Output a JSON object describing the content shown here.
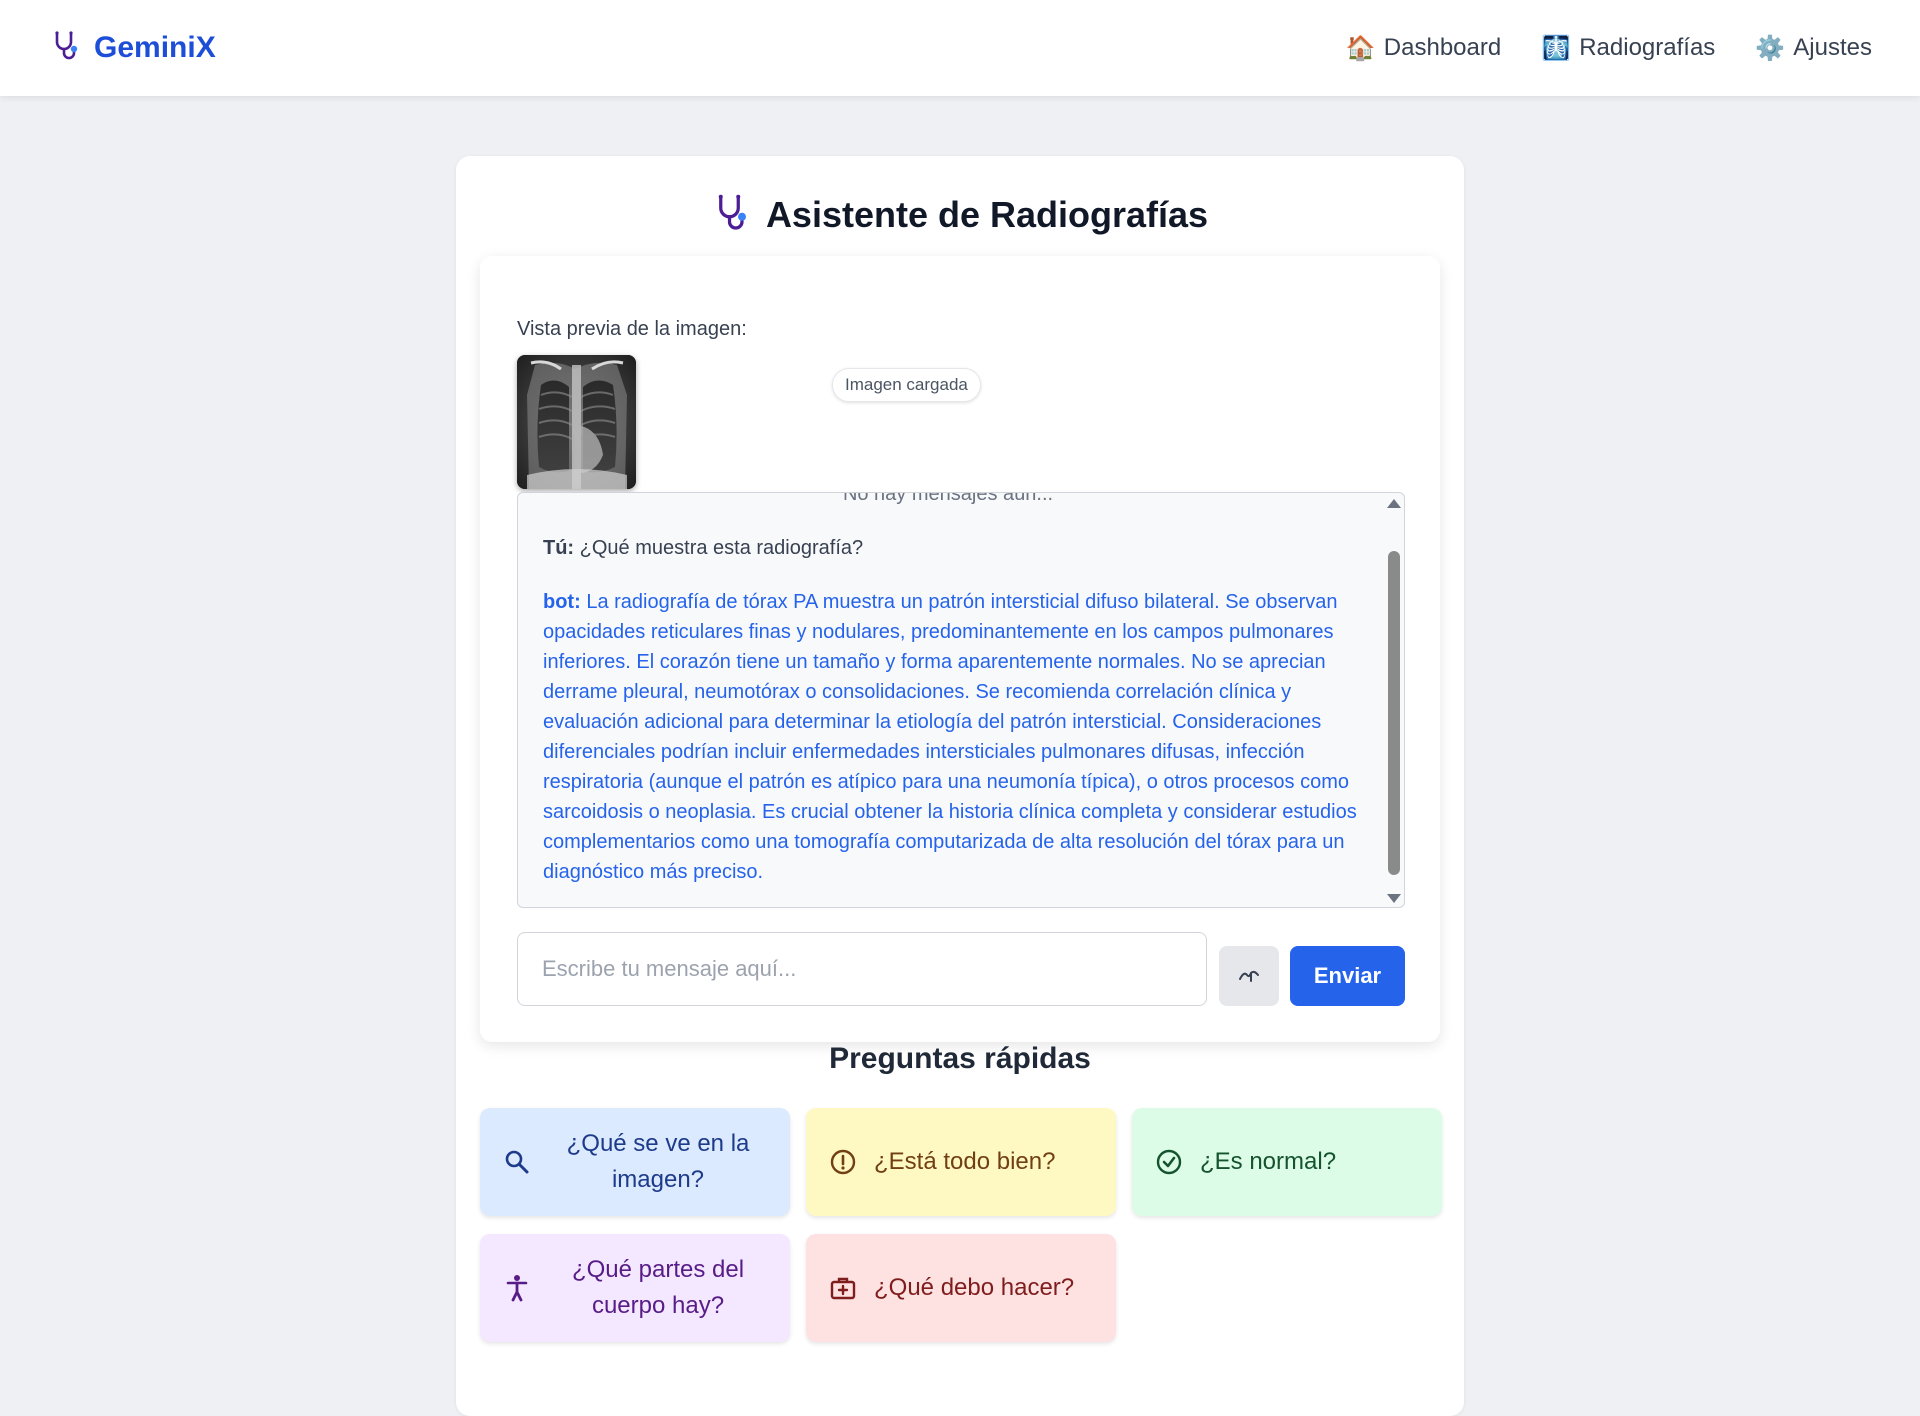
{
  "app": {
    "name": "GeminiX",
    "logo_icon": "stethoscope-icon",
    "brand_color": "#1d4ed8"
  },
  "nav": {
    "items": [
      {
        "label": "Dashboard",
        "icon": "house-icon"
      },
      {
        "label": "Radiografías",
        "icon": "xray-skull-icon"
      },
      {
        "label": "Ajustes",
        "icon": "gear-icon"
      }
    ]
  },
  "assistant": {
    "title": "Asistente de Radiografías",
    "title_icon": "stethoscope-icon",
    "preview_label": "Vista previa de la imagen:",
    "image_status": "Imagen cargada",
    "empty_text": "No hay mensajes aún...",
    "messages": [
      {
        "sender": "Tú:",
        "text": "¿Qué muestra esta radiografía?"
      },
      {
        "sender": "bot:",
        "text": "La radiografía de tórax PA muestra un patrón intersticial difuso bilateral. Se observan opacidades reticulares finas y nodulares, predominantemente en los campos pulmonares inferiores. El corazón tiene un tamaño y forma aparentemente normales. No se aprecian derrame pleural, neumotórax o consolidaciones. Se recomienda correlación clínica y evaluación adicional para determinar la etiología del patrón intersticial. Consideraciones diferenciales podrían incluir enfermedades intersticiales pulmonares difusas, infección respiratoria (aunque el patrón es atípico para una neumonía típica), o otros procesos como sarcoidosis o neoplasia. Es crucial obtener la historia clínica completa y considerar estudios complementarios como una tomografía computarizada de alta resolución del tórax para un diagnóstico más preciso."
      }
    ],
    "input_placeholder": "Escribe tu mensaje aquí...",
    "input_value": "",
    "mic_icon": "microphone-wave-icon",
    "send_label": "Enviar",
    "accent_color": "#2563eb"
  },
  "quick": {
    "title": "Preguntas rápidas",
    "buttons": [
      {
        "label": "¿Qué se ve en la imagen?",
        "icon": "search-icon",
        "color": "#dbeafe"
      },
      {
        "label": "¿Está todo bien?",
        "icon": "alert-circle-icon",
        "color": "#fef9c3"
      },
      {
        "label": "¿Es normal?",
        "icon": "check-circle-icon",
        "color": "#dcfce7"
      },
      {
        "label": "¿Qué partes del cuerpo hay?",
        "icon": "person-icon",
        "color": "#f3e8ff"
      },
      {
        "label": "¿Qué debo hacer?",
        "icon": "medical-kit-icon",
        "color": "#fee2e2"
      }
    ]
  }
}
